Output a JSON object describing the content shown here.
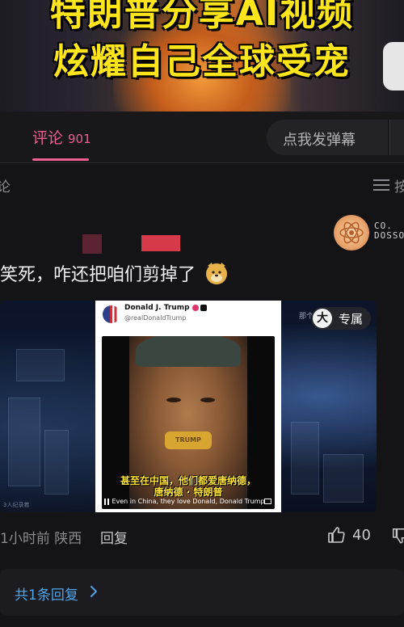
{
  "video_banner": {
    "title_line1": "特朗普分享AI视频",
    "title_line2": "炫耀自己全球受宠"
  },
  "tabs": {
    "comments_label": "评论",
    "comments_count": "901"
  },
  "danmaku": {
    "placeholder": "点我发弹幕"
  },
  "sort": {
    "left_label": "论",
    "right_label": "按"
  },
  "comment": {
    "user_tag_line1": "CO.",
    "user_tag_line2": "DOSSO",
    "text": "笑死，咋还把咱们剪掉了",
    "image": {
      "tweet_name": "Donald J. Trump",
      "tweet_handle": "@realDonaldTrump",
      "mouth_text": "TRUMP",
      "subtitle_cn_1": "甚至在中国，他们都爱唐纳德，",
      "subtitle_cn_2": "唐纳德 · 特朗普",
      "subtitle_en": "Even in China, they love Donald, Donald Trump",
      "exclusive_icon": "大",
      "exclusive_label": "专属",
      "top_right_hint": "那个",
      "watermark": "3人纪录着"
    },
    "time": "1小时前",
    "location": "陕西",
    "reply_label": "回复",
    "like_count": "40"
  },
  "replies": {
    "label": "共1条回复"
  },
  "colors": {
    "accent_pink": "#ec5f8e",
    "link_blue": "#4fa3e6",
    "background": "#141416"
  }
}
